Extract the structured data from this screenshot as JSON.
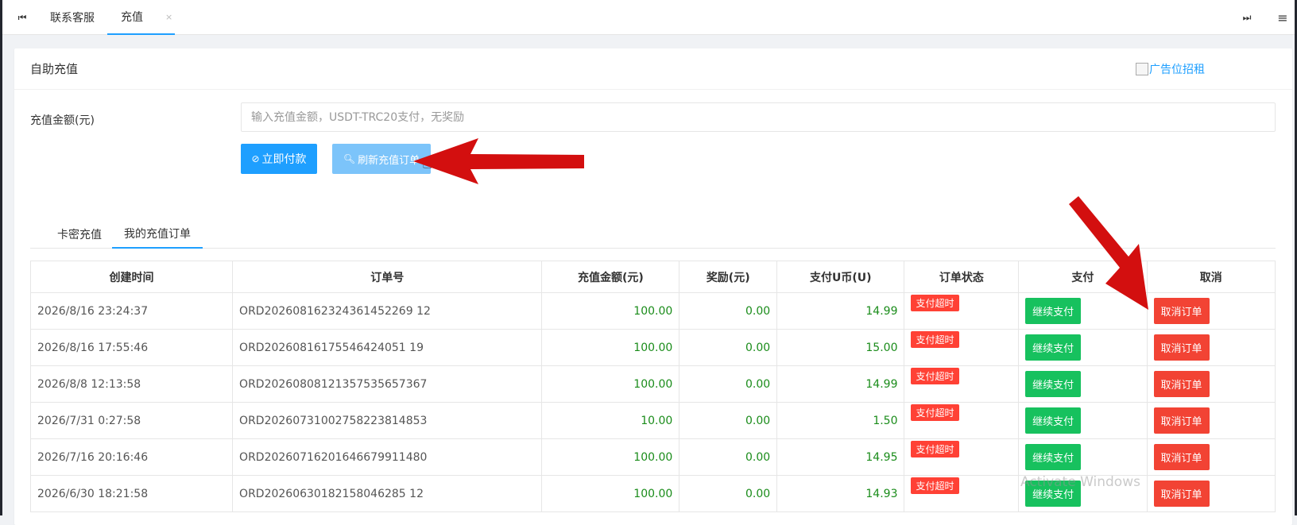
{
  "tabbar": {
    "prev_icon": "⏮",
    "next_icon": "⏭",
    "menu_icon": "≡",
    "tabs": [
      {
        "label": "联系客服"
      },
      {
        "label": "充值",
        "close": "×"
      }
    ]
  },
  "card": {
    "title": "自助充值",
    "ad_text": "广告位招租",
    "form": {
      "amount_label": "充值金额(元)",
      "amount_placeholder": "输入充值金额，USDT-TRC20支付，无奖励"
    },
    "buttons": {
      "pay": "立即付款",
      "refresh": "刷新充值订单"
    },
    "inner_tabs": [
      {
        "label": "卡密充值"
      },
      {
        "label": "我的充值订单"
      }
    ],
    "table": {
      "headers": [
        "创建时间",
        "订单号",
        "充值金额(元)",
        "奖励(元)",
        "支付U币(U)",
        "订单状态",
        "支付",
        "取消"
      ],
      "rows": [
        {
          "time": "2026/8/16 23:24:37",
          "order": "ORD202608162324361452269 12",
          "amount": "100.00",
          "bonus": "0.00",
          "usdt": "14.99",
          "status": "支付超时",
          "pay": "继续支付",
          "cancel": "取消订单"
        },
        {
          "time": "2026/8/16 17:55:46",
          "order": "ORD20260816175546424051 19",
          "amount": "100.00",
          "bonus": "0.00",
          "usdt": "15.00",
          "status": "支付超时",
          "pay": "继续支付",
          "cancel": "取消订单"
        },
        {
          "time": "2026/8/8 12:13:58",
          "order": "ORD20260808121357535657367",
          "amount": "100.00",
          "bonus": "0.00",
          "usdt": "14.99",
          "status": "支付超时",
          "pay": "继续支付",
          "cancel": "取消订单"
        },
        {
          "time": "2026/7/31 0:27:58",
          "order": "ORD20260731002758223814853",
          "amount": "10.00",
          "bonus": "0.00",
          "usdt": "1.50",
          "status": "支付超时",
          "pay": "继续支付",
          "cancel": "取消订单"
        },
        {
          "time": "2026/7/16 20:16:46",
          "order": "ORD20260716201646679911480",
          "amount": "100.00",
          "bonus": "0.00",
          "usdt": "14.95",
          "status": "支付超时",
          "pay": "继续支付",
          "cancel": "取消订单"
        },
        {
          "time": "2026/6/30 18:21:58",
          "order": "ORD20260630182158046285 12",
          "amount": "100.00",
          "bonus": "0.00",
          "usdt": "14.93",
          "status": "支付超时",
          "pay": "继续支付",
          "cancel": "取消订单"
        }
      ]
    }
  },
  "watermark": "Activate Windows",
  "colors": {
    "primary": "#1e9fff",
    "primary_light": "#7cc4fa",
    "success": "#17c15e",
    "danger": "#f24334",
    "amount_green": "#1a8c1a",
    "annotation_arrow": "#d30f0f"
  }
}
